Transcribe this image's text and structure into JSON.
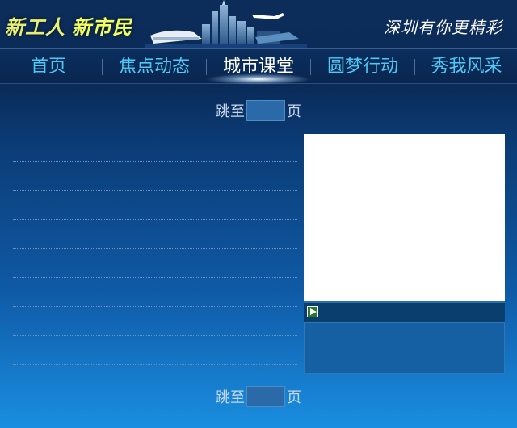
{
  "header": {
    "slogan_left_1": "新工人",
    "slogan_left_2": "新市民",
    "slogan_right": "深圳有你更精彩"
  },
  "nav": {
    "items": [
      {
        "label": "首页"
      },
      {
        "label": "焦点动态"
      },
      {
        "label": "城市课堂",
        "active": true
      },
      {
        "label": "圆梦行动"
      },
      {
        "label": "秀我风采"
      }
    ]
  },
  "pager": {
    "prefix": "跳至",
    "suffix": "页"
  },
  "video": {
    "play_icon": "play-icon"
  },
  "colors": {
    "nav_text": "#4ec8f4",
    "nav_active": "#ffffff",
    "slogan_green": "#e8f06f"
  }
}
